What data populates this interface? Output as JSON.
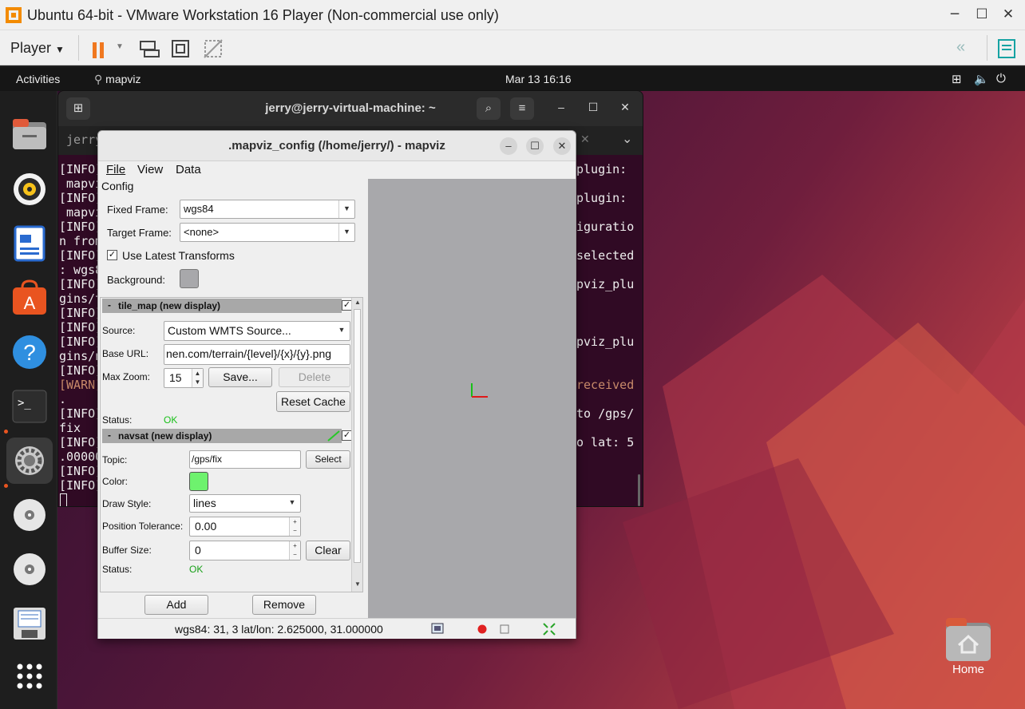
{
  "vmware": {
    "title": "Ubuntu 64-bit - VMware Workstation 16 Player (Non-commercial use only)",
    "player_menu": "Player",
    "minimize": "─",
    "maximize": "☐",
    "close": "✕"
  },
  "gnome": {
    "activities": "Activities",
    "app_name": "mapviz",
    "clock": "Mar 13  16:16"
  },
  "dock": {
    "items": [
      "files-icon",
      "rhythmbox-icon",
      "writer-icon",
      "app-center-icon",
      "help-icon",
      "terminal-icon",
      "settings-icon",
      "disc-icon",
      "disc-icon",
      "floppy-icon",
      "app-grid-icon"
    ]
  },
  "desktop": {
    "home_label": "Home"
  },
  "terminal": {
    "title": "jerry@jerry-virtual-machine: ~",
    "tab_label": "jerry",
    "tab_close": "✕",
    "tab_menu": "⌄",
    "left_lines": [
      "[INFO]",
      " mapvi",
      "[INFO]",
      " mapvi",
      "[INFO]",
      "n from",
      "[INFO]",
      ": wgs8",
      "[INFO]",
      "gins/t",
      "[INFO]",
      "[INFO]",
      "[INFO]",
      "gins/n",
      "[INFO]",
      "[WARN]",
      ".",
      "[INFO]",
      "fix",
      "[INFO]",
      ".00000",
      "[INFO]",
      "[INFO]"
    ],
    "right_lines": [
      "plugin:",
      "",
      "plugin:",
      "",
      "iguratio",
      "",
      "selected",
      "",
      "pviz_plu",
      "",
      "",
      "",
      "pviz_plu",
      "",
      "",
      "received",
      "",
      "to /gps/",
      "",
      "o lat: 5",
      "",
      "",
      ""
    ]
  },
  "mapviz": {
    "title": ".mapviz_config (/home/jerry/) - mapviz",
    "menu": [
      "File",
      "View",
      "Data"
    ],
    "config_label": "Config",
    "fixed_frame_label": "Fixed Frame:",
    "fixed_frame_value": "wgs84",
    "target_frame_label": "Target Frame:",
    "target_frame_value": "<none>",
    "use_latest_transforms": "Use Latest Transforms",
    "use_latest_checked": true,
    "background_label": "Background:",
    "tile_map": {
      "header": "tile_map (new display)",
      "collapse": "-",
      "source_label": "Source:",
      "source_value": "Custom WMTS Source...",
      "base_url_label": "Base URL:",
      "base_url_value": "nen.com/terrain/{level}/{x}/{y}.png",
      "max_zoom_label": "Max Zoom:",
      "max_zoom_value": "15",
      "save_button": "Save...",
      "delete_button": "Delete",
      "reset_cache_button": "Reset Cache",
      "status_label": "Status:",
      "status_value": "OK"
    },
    "navsat": {
      "header": "navsat (new display)",
      "collapse": "-",
      "topic_label": "Topic:",
      "topic_value": "/gps/fix",
      "select_button": "Select",
      "color_label": "Color:",
      "color_value": "#6ef26e",
      "draw_style_label": "Draw Style:",
      "draw_style_value": "lines",
      "position_tolerance_label": "Position Tolerance:",
      "position_tolerance_value": "0.00",
      "buffer_size_label": "Buffer Size:",
      "buffer_size_value": "0",
      "clear_button": "Clear",
      "status_label": "Status:",
      "status_value": "OK"
    },
    "add_button": "Add",
    "remove_button": "Remove",
    "status_bar": "wgs84: 31, 3  lat/lon: 2.625000, 31.000000"
  },
  "colors": {
    "accent": "#e95420",
    "ok_green": "#28a428",
    "viewport_bg": "#a8a8ab",
    "terminal_bg": "#300a24"
  }
}
